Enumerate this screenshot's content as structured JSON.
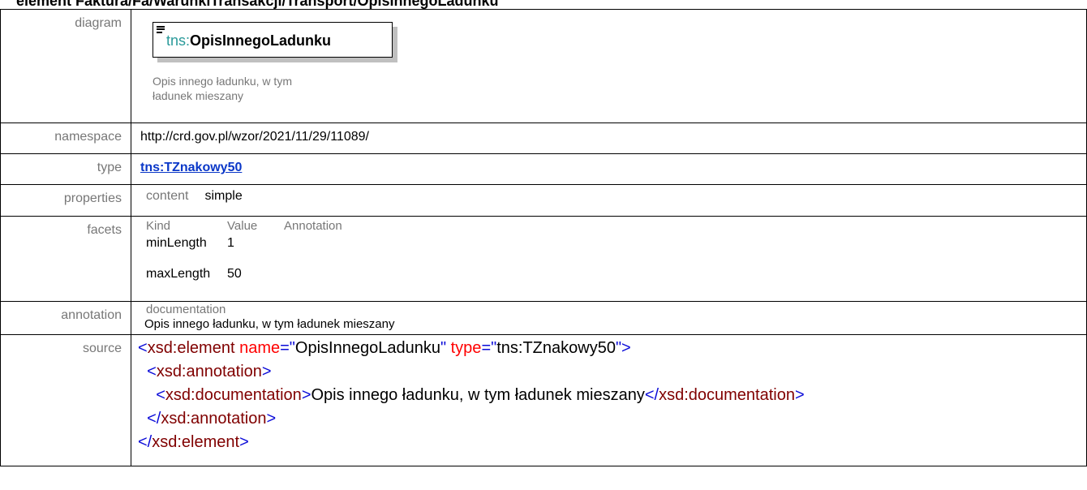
{
  "page": {
    "title": "element Faktura/Fa/WarunkiTransakcji/Transport/OpisInnegoLadunku"
  },
  "labels": {
    "diagram": "diagram",
    "namespace": "namespace",
    "type": "type",
    "properties": "properties",
    "facets": "facets",
    "annotation": "annotation",
    "source": "source"
  },
  "diagram": {
    "prefix": "tns:",
    "element_name": "OpisInnegoLadunku",
    "documentation": "Opis innego ładunku, w tym ładunek mieszany",
    "icon": "element-list-icon"
  },
  "namespace": "http://crd.gov.pl/wzor/2021/11/29/11089/",
  "type": "tns:TZnakowy50",
  "properties": {
    "key": "content",
    "value": "simple"
  },
  "facets": {
    "headers": [
      "Kind",
      "Value",
      "Annotation"
    ],
    "rows": [
      {
        "kind": "minLength",
        "value": "1"
      },
      {
        "kind": "maxLength",
        "value": "50"
      }
    ]
  },
  "annotation": {
    "key": "documentation",
    "text": "Opis innego ładunku, w tym ładunek mieszany"
  },
  "source": {
    "open_tag": "xsd:element",
    "attr_name": "name",
    "attr_name_value": "OpisInnegoLadunku",
    "attr_type": "type",
    "attr_type_value": "tns:TZnakowy50",
    "annotation_tag": "xsd:annotation",
    "documentation_tag": "xsd:documentation",
    "documentation_text": "Opis innego ładunku, w tym ładunek mieszany"
  },
  "colors": {
    "label_gray": "#777777",
    "link_blue": "#0a37c8",
    "xml_tag_blue": "#0a0ad8",
    "xml_name_maroon": "#800000",
    "xml_attr_red": "#ff0000",
    "prefix_teal": "#2a9a9a"
  }
}
